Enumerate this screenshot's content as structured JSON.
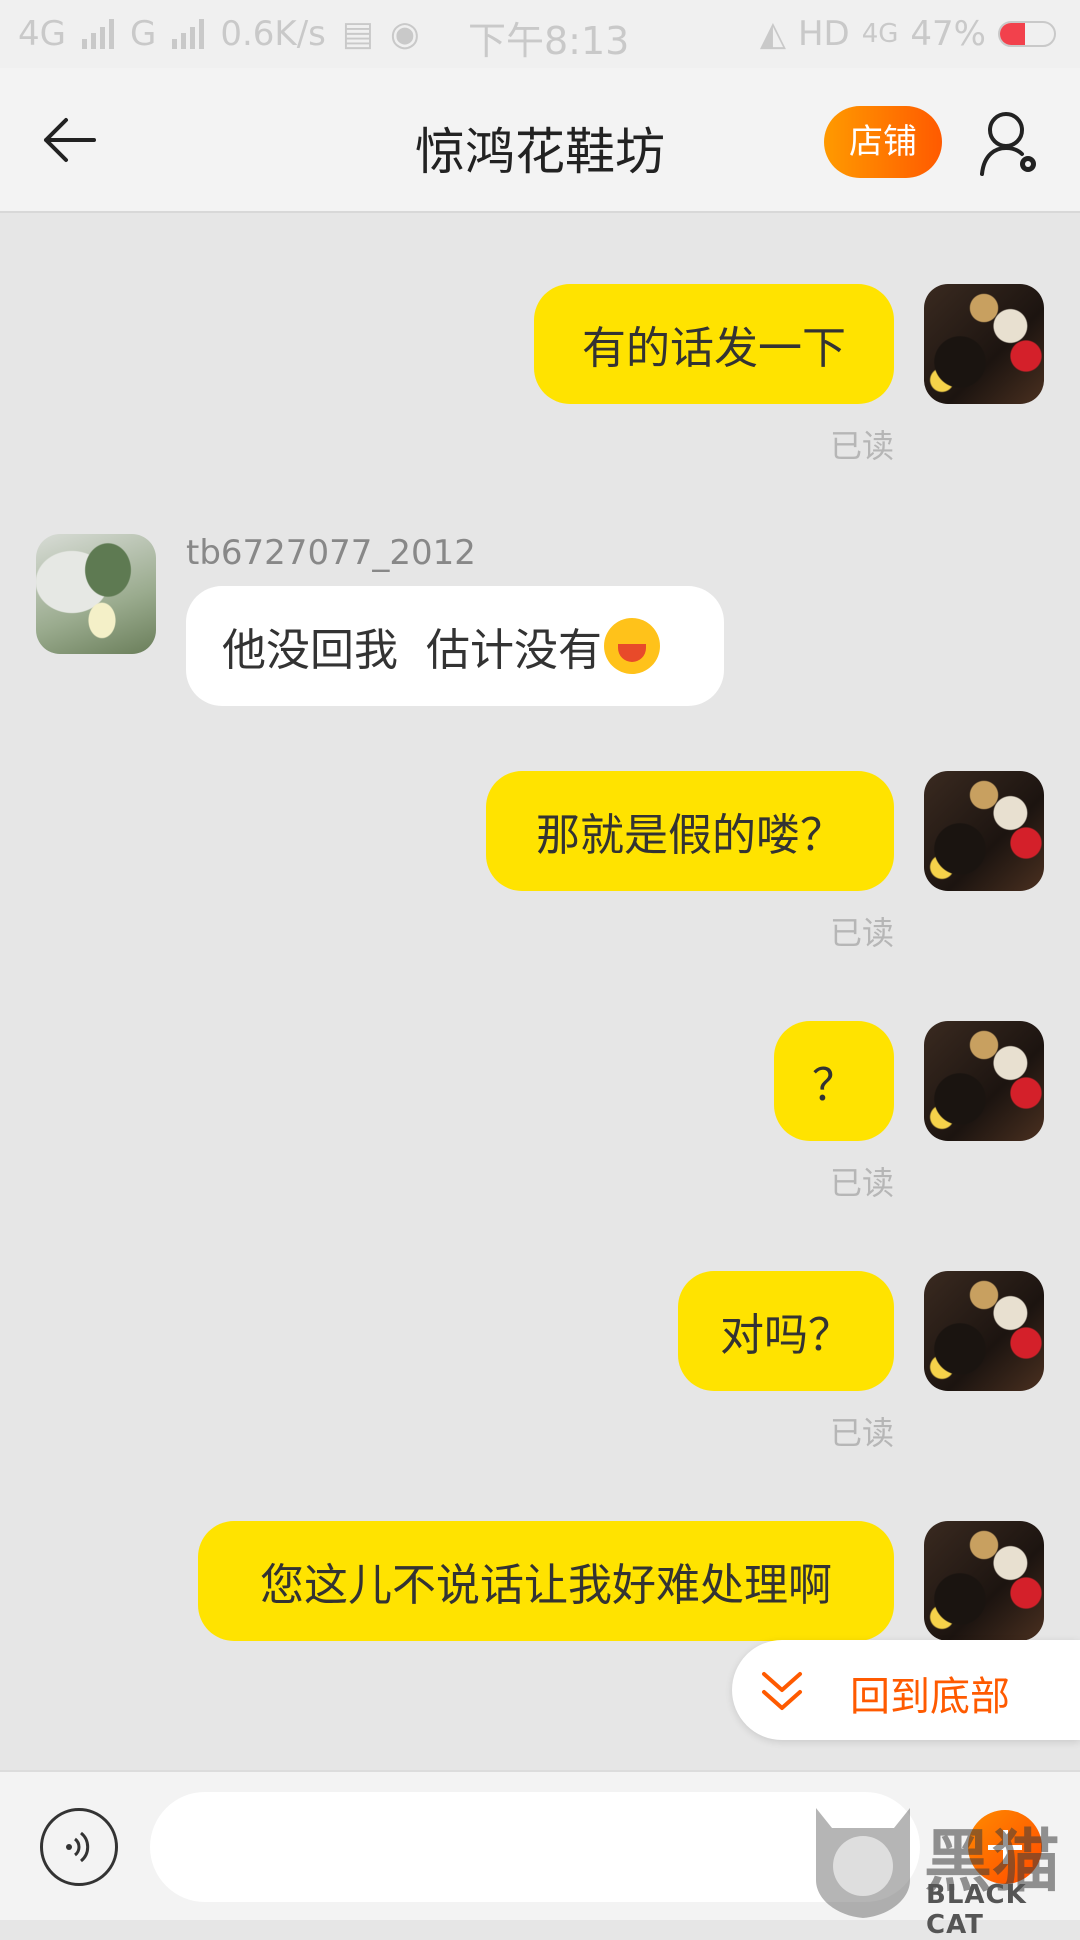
{
  "status_bar": {
    "net1": "4G",
    "net2": "G",
    "speed": "0.6K/s",
    "time": "下午8:13",
    "hd": "HD",
    "net3": "4G",
    "battery": "47%",
    "battery_level": 0.47
  },
  "nav": {
    "title": "惊鸿花鞋坊",
    "shop_label": "店铺"
  },
  "messages": [
    {
      "text": "有的话发一下",
      "read": "已读"
    },
    {
      "sender": "tb6727077_2012",
      "text": "他没回我  估计没有"
    },
    {
      "text": "那就是假的喽？",
      "read": "已读"
    },
    {
      "text": "？",
      "read": "已读"
    },
    {
      "text": "对吗？",
      "read": "已读"
    },
    {
      "text": "您这儿不说话让我好难处理啊"
    }
  ],
  "to_bottom_label": "回到底部",
  "input": {
    "placeholder": "",
    "value": ""
  },
  "watermark": {
    "cn": "黑猫",
    "en": "BLACK CAT"
  },
  "colors": {
    "accent": "#ff5a00",
    "bubble_out": "#ffe300",
    "bubble_in": "#ffffff"
  }
}
